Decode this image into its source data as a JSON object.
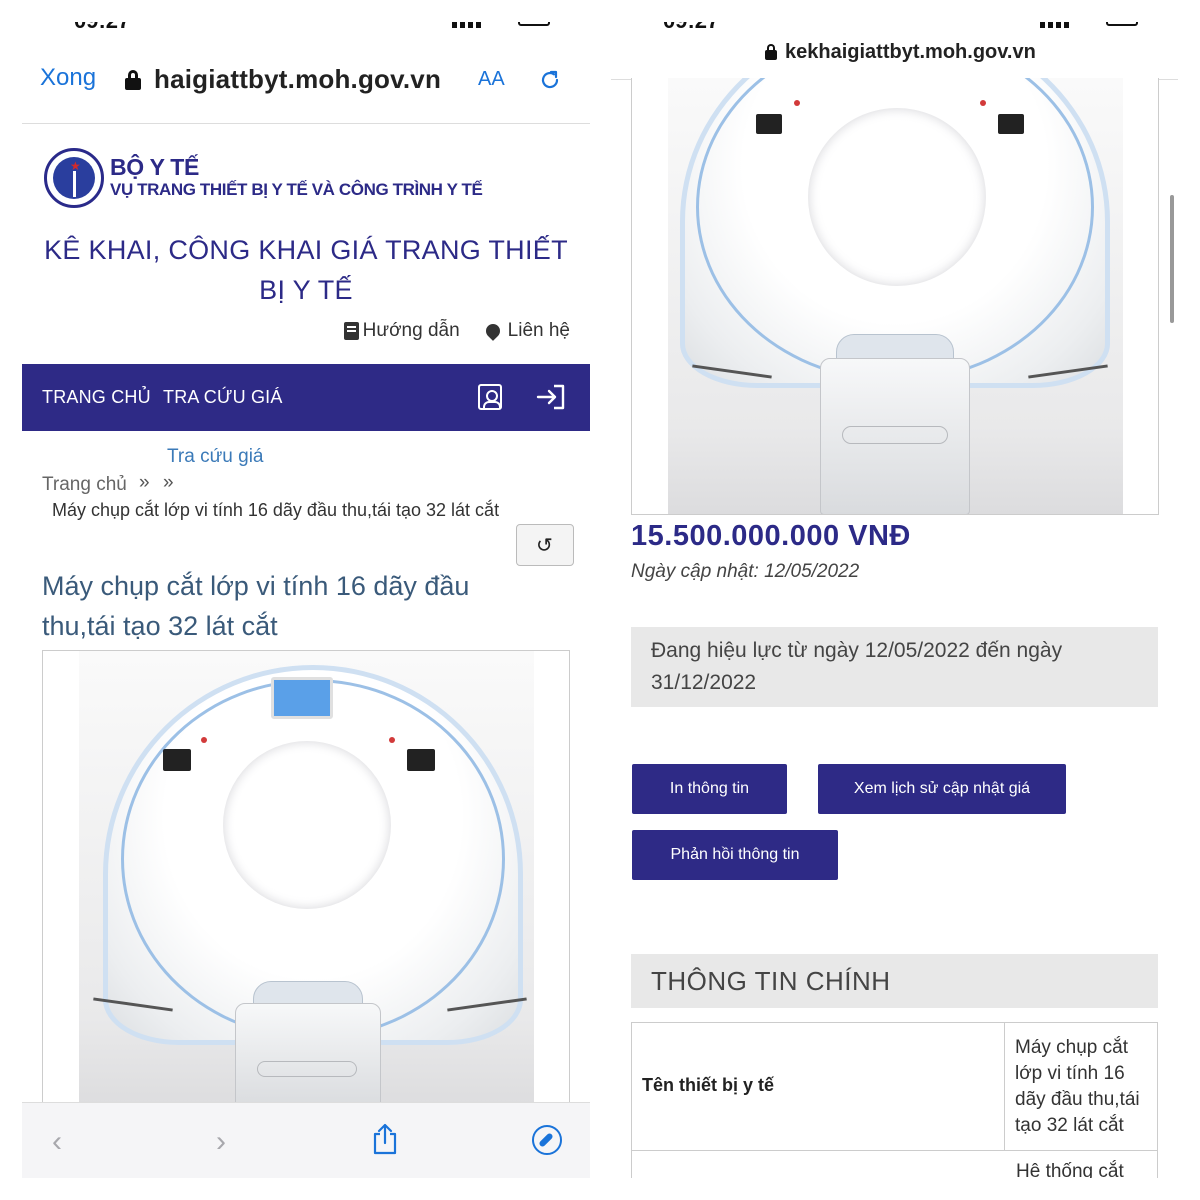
{
  "left": {
    "status": {
      "time": "09:27"
    },
    "safari": {
      "done_label": "Xong",
      "url": "haigiattbyt.moh.gov.vn",
      "text_size_label": "AA"
    },
    "header": {
      "org_name": "BỘ Y TẾ",
      "org_dept": "VỤ TRANG THIẾT BỊ Y TẾ VÀ CÔNG TRÌNH Y TẾ",
      "site_title": "KÊ KHAI, CÔNG KHAI GIÁ TRANG THIẾT BỊ Y TẾ",
      "link_guide": "Hướng dẫn",
      "link_contact": "Liên hệ"
    },
    "nav": {
      "home": "TRANG CHỦ",
      "price_lookup": "TRA CỨU GIÁ"
    },
    "breadcrumb": {
      "sub": "Tra cứu giá",
      "home": "Trang chủ",
      "sep": "»",
      "current": "Máy chụp cắt lớp vi tính 16 dãy đầu thu,tái tạo 32 lát cắt"
    },
    "product_title": "Máy chụp cắt lớp vi tính 16 dãy đầu thu,tái tạo 32 lát cắt",
    "icons": {
      "undo": "↺",
      "back": "‹",
      "forward": "›"
    }
  },
  "right": {
    "status": {
      "time": "09:27"
    },
    "url": "kekhaigiattbyt.moh.gov.vn",
    "price": "15.500.000.000 VNĐ",
    "updated": "Ngày cập nhật: 12/05/2022",
    "validity": "Đang hiệu lực từ ngày 12/05/2022 đến ngày 31/12/2022",
    "buttons": {
      "print": "In thông tin",
      "history": "Xem lịch sử cập nhật giá",
      "feedback": "Phản hồi thông tin"
    },
    "section_title": "THÔNG TIN CHÍNH",
    "table": {
      "label1": "Tên thiết bị y tế",
      "value1": "Máy chụp cắt lớp vi tính 16 dãy đầu thu,tái tạo 32 lát cắt",
      "value2_partial": "Hệ thống cắt"
    }
  },
  "colors": {
    "brand": "#2e2a86",
    "link": "#1a73d9",
    "breadcrumb_link": "#3b7ab8"
  }
}
